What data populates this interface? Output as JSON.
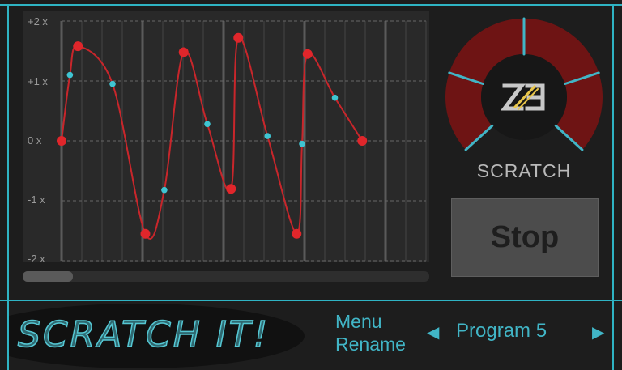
{
  "graph": {
    "y_labels": [
      "+2 x",
      "+1 x",
      "0 x",
      "-1 x",
      "-2 x"
    ],
    "y_values": [
      2,
      1,
      0,
      -1,
      -2
    ],
    "nodes": [
      {
        "t": 0.0,
        "v": 0.0
      },
      {
        "t": 0.045,
        "v": 1.58
      },
      {
        "t": 0.23,
        "v": -1.55
      },
      {
        "t": 0.335,
        "v": 1.48
      },
      {
        "t": 0.465,
        "v": -0.8
      },
      {
        "t": 0.485,
        "v": 1.72
      },
      {
        "t": 0.645,
        "v": -1.55
      },
      {
        "t": 0.675,
        "v": 1.45
      },
      {
        "t": 0.825,
        "v": 0.0
      }
    ],
    "handles": [
      {
        "t": 0.023,
        "v": 1.1
      },
      {
        "t": 0.14,
        "v": 0.95
      },
      {
        "t": 0.282,
        "v": -0.82
      },
      {
        "t": 0.4,
        "v": 0.28
      },
      {
        "t": 0.565,
        "v": 0.08
      },
      {
        "t": 0.66,
        "v": -0.05
      },
      {
        "t": 0.75,
        "v": 0.72
      }
    ],
    "scroll_position": 0.12
  },
  "knob": {
    "label": "SCRATCH",
    "logo": "Z3 logo",
    "icon": "scratch-dial-icon"
  },
  "stop_button_label": "Stop",
  "footer": {
    "logo_text": "SCRATCH IT!",
    "menu_label": "Menu",
    "rename_label": "Rename",
    "prev_icon": "◀",
    "program_name": "Program 5",
    "next_icon": "▶"
  },
  "colors": {
    "accent": "#41b5c6",
    "curve": "#c8262b",
    "knob_red": "#6e1414",
    "background": "#1d1d1d"
  }
}
